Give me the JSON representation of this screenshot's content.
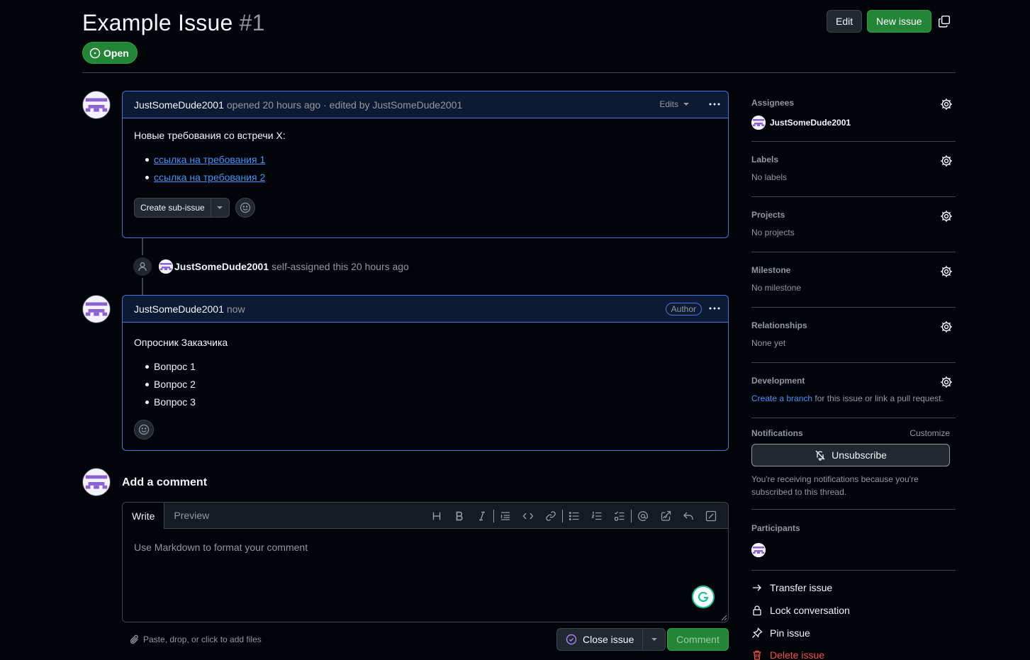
{
  "issue": {
    "title": "Example Issue",
    "number": "#1",
    "state": "Open"
  },
  "header": {
    "edit_label": "Edit",
    "new_issue_label": "New issue"
  },
  "comments": [
    {
      "author": "JustSomeDude2001",
      "meta": "opened 20 hours ago · edited by JustSomeDude2001",
      "edits_label": "Edits",
      "body_text": "Новые требования со встречи X:",
      "links": [
        "ссылка на требования 1",
        "ссылка на требования 2"
      ],
      "sub_issue_label": "Create sub-issue"
    },
    {
      "author": "JustSomeDude2001",
      "meta": "now",
      "badge": "Author",
      "body_text": "Опросник Заказчика",
      "items": [
        "Вопрос 1",
        "Вопрос 2",
        "Вопрос 3"
      ]
    }
  ],
  "timeline_event": {
    "actor": "JustSomeDude2001",
    "text": "self-assigned this 20 hours ago"
  },
  "composer": {
    "title": "Add a comment",
    "tab_write": "Write",
    "tab_preview": "Preview",
    "placeholder": "Use Markdown to format your comment",
    "files_hint": "Paste, drop, or click to add files",
    "close_label": "Close issue",
    "comment_label": "Comment"
  },
  "sidebar": {
    "assignees": {
      "title": "Assignees",
      "user": "JustSomeDude2001"
    },
    "labels": {
      "title": "Labels",
      "value": "No labels"
    },
    "projects": {
      "title": "Projects",
      "value": "No projects"
    },
    "milestone": {
      "title": "Milestone",
      "value": "No milestone"
    },
    "relationships": {
      "title": "Relationships",
      "value": "None yet"
    },
    "development": {
      "title": "Development",
      "link": "Create a branch",
      "rest": "for this issue or link a pull request."
    },
    "notifications": {
      "title": "Notifications",
      "customize": "Customize",
      "unsubscribe": "Unsubscribe",
      "notice": "You're receiving notifications because you're subscribed to this thread."
    },
    "participants": {
      "title": "Participants"
    },
    "actions": {
      "transfer": "Transfer issue",
      "lock": "Lock conversation",
      "pin": "Pin issue",
      "delete": "Delete issue"
    }
  },
  "colors": {
    "background": "#010409",
    "accent_green": "#238636",
    "link_blue": "#4493f8",
    "danger": "#f85149",
    "avatar_purple": "#8a63d2"
  }
}
